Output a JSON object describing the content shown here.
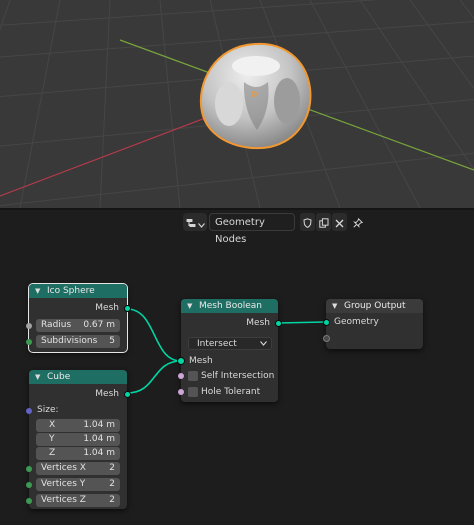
{
  "colors": {
    "node_header_geometry": "#1f6e63",
    "node_header_output": "#3b3b3b",
    "socket_geometry": "#00d6a3",
    "socket_float": "#a1a1a1",
    "socket_integer": "#3c9a53",
    "socket_vector": "#6363c7",
    "socket_boolean": "#cca6d6",
    "selection_outline": "#f29830",
    "axis_x": "#b43a4b",
    "axis_y": "#78a43b"
  },
  "editor_header": {
    "editor_type_icon": "node-editor-icon",
    "node_tree_name": "Geometry Nodes",
    "icons": [
      "shield-icon",
      "duplicate-icon",
      "close-icon",
      "pin-icon"
    ]
  },
  "nodes": {
    "ico_sphere": {
      "title": "Ico Sphere",
      "output_label": "Mesh",
      "radius_label": "Radius",
      "radius_value": "0.67 m",
      "subdivisions_label": "Subdivisions",
      "subdivisions_value": "5"
    },
    "cube": {
      "title": "Cube",
      "output_label": "Mesh",
      "size_label": "Size:",
      "x_label": "X",
      "x_value": "1.04 m",
      "y_label": "Y",
      "y_value": "1.04 m",
      "z_label": "Z",
      "z_value": "1.04 m",
      "vertices_x_label": "Vertices X",
      "vertices_x_value": "2",
      "vertices_y_label": "Vertices Y",
      "vertices_y_value": "2",
      "vertices_z_label": "Vertices Z",
      "vertices_z_value": "2"
    },
    "mesh_boolean": {
      "title": "Mesh Boolean",
      "output_label": "Mesh",
      "operation": "Intersect",
      "mesh_input_label": "Mesh",
      "self_intersection_label": "Self Intersection",
      "hole_tolerant_label": "Hole Tolerant"
    },
    "group_output": {
      "title": "Group Output",
      "geometry_label": "Geometry"
    }
  }
}
